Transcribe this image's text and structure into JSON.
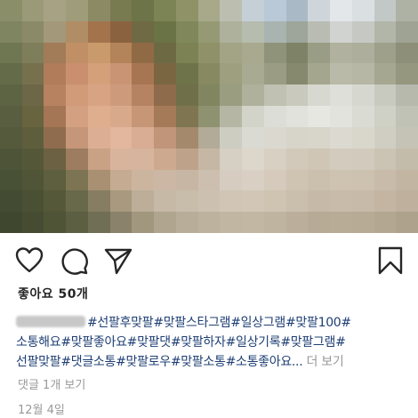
{
  "post": {
    "photo_colors": [
      "#8a8f6a",
      "#9a9a78",
      "#a7a284",
      "#9f9c7a",
      "#8c8a64",
      "#787a50",
      "#6d7447",
      "#7c8456",
      "#8e9266",
      "#a8a88a",
      "#bcbfb0",
      "#c5cfd6",
      "#b9c9d8",
      "#aab9c6",
      "#cfd6db",
      "#e3e7ea",
      "#dadfe2",
      "#c2c8c6",
      "#aeb2a5",
      "#7f8560",
      "#8b8a68",
      "#a3987a",
      "#b18d66",
      "#a3744c",
      "#8b6240",
      "#6f6a44",
      "#6a7345",
      "#80875a",
      "#959a74",
      "#aeb19b",
      "#b6bcae",
      "#a9b4b1",
      "#9ea59a",
      "#b8bcb2",
      "#d0d3d0",
      "#c6c9c3",
      "#b2b6a9",
      "#9fa393",
      "#6f7652",
      "#7e7f5a",
      "#a27b58",
      "#c08f66",
      "#c99a6c",
      "#b38459",
      "#8f6a45",
      "#6d6a43",
      "#7d8254",
      "#8f9268",
      "#a3a485",
      "#a8a98e",
      "#8f937a",
      "#7e8266",
      "#9a9d85",
      "#b0b19e",
      "#adaf9c",
      "#9ea08b",
      "#8d8f78",
      "#646b48",
      "#76704d",
      "#b07c5a",
      "#c98f6f",
      "#d4a07a",
      "#c99474",
      "#a87553",
      "#7a6742",
      "#6f7349",
      "#878a60",
      "#9d9f7f",
      "#a9aa92",
      "#9a9d83",
      "#86896e",
      "#a5a68e",
      "#b9baa7",
      "#b6b7a4",
      "#a6a791",
      "#95977f",
      "#5d6443",
      "#6d6747",
      "#b7825f",
      "#d19a78",
      "#d8a383",
      "#cd9b7b",
      "#b58362",
      "#8e6b4a",
      "#6f7049",
      "#828660",
      "#9b9d80",
      "#b0b19c",
      "#c0c1b2",
      "#c9cabd",
      "#d7d8cf",
      "#dedfd8",
      "#d6d8d0",
      "#c8cac0",
      "#b7b9ad",
      "#585e3f",
      "#68643f",
      "#a47656",
      "#d3a082",
      "#dfae8f",
      "#d9a98c",
      "#c79677",
      "#a47a58",
      "#7f7651",
      "#8f9270",
      "#b5b6a4",
      "#d2d3c9",
      "#dcddd6",
      "#e2e2dc",
      "#e7e7e2",
      "#e3e3dd",
      "#dadbd3",
      "#cfd0c6",
      "#c0c2b6",
      "#555a3d",
      "#5e5e3d",
      "#8f6c4e",
      "#c59678",
      "#dcae93",
      "#e2b79e",
      "#d9ad93",
      "#c0957a",
      "#a5896c",
      "#b1ab97",
      "#cdcdc1",
      "#dbdad2",
      "#dbd9cf",
      "#d7d4c9",
      "#d8d5ca",
      "#dcdad0",
      "#d9d7cc",
      "#d0cec2",
      "#c5c3b5",
      "#4e5438",
      "#555838",
      "#6c6142",
      "#9d7c60",
      "#c9a185",
      "#d9b49c",
      "#d7b49d",
      "#cca98f",
      "#bfa28a",
      "#c6b7a5",
      "#d6cfc3",
      "#dcd6cb",
      "#d8d0c3",
      "#d2c9ba",
      "#cfc6b6",
      "#d3cbbd",
      "#d2cabc",
      "#cbc3b3",
      "#c4bcaa",
      "#485036",
      "#4f5536",
      "#5d5f3e",
      "#7d7453",
      "#a99073",
      "#c4ab92",
      "#ccb59f",
      "#cbb7a3",
      "#c7b6a3",
      "#cdbfb0",
      "#d6ccbf",
      "#d9cfc2",
      "#d5cabb",
      "#cfc3b2",
      "#cbbfad",
      "#cec2b1",
      "#cdc1b0",
      "#c8bba9",
      "#c2b5a2",
      "#434b33",
      "#4a5034",
      "#55593a",
      "#68684a",
      "#877d63",
      "#a8997f",
      "#bcae98",
      "#c6b9a6",
      "#c8bcaa",
      "#ccc1b0",
      "#d1c6b6",
      "#d2c7b7",
      "#cfc3b2",
      "#cabead",
      "#c6b9a7",
      "#c8bba9",
      "#c7baa8",
      "#c3b5a2",
      "#beb09c",
      "#3f472f",
      "#454c31",
      "#4f5436",
      "#5c5f42",
      "#706e54",
      "#8a826a",
      "#a1977f",
      "#b0a58f",
      "#b8ad98",
      "#bdb29e",
      "#c1b6a2",
      "#c2b7a3",
      "#bfb4a0",
      "#bbaf9b",
      "#b7ab96",
      "#b8ac97",
      "#b7ab96",
      "#b3a792",
      "#aea28d"
    ],
    "icons": {
      "like": "heart-icon",
      "comment": "comment-icon",
      "share": "send-icon",
      "save": "bookmark-icon"
    },
    "likes_text": "좋아요 50개",
    "caption": {
      "line1": "#선팔후맞팔#맞팔스타그램#일상그램#맞팔100#",
      "line2": "소통해요#맞팔좋아요#맞팔댓#맞팔하자#일상기록#맞팔그램#",
      "line3": "선팔맞팔#댓글소통#맞팔로우#맞팔소통#소통좋아요...",
      "more": "더 보기"
    },
    "comments_text": "댓글 1개 보기",
    "date_text": "12월 4일"
  }
}
